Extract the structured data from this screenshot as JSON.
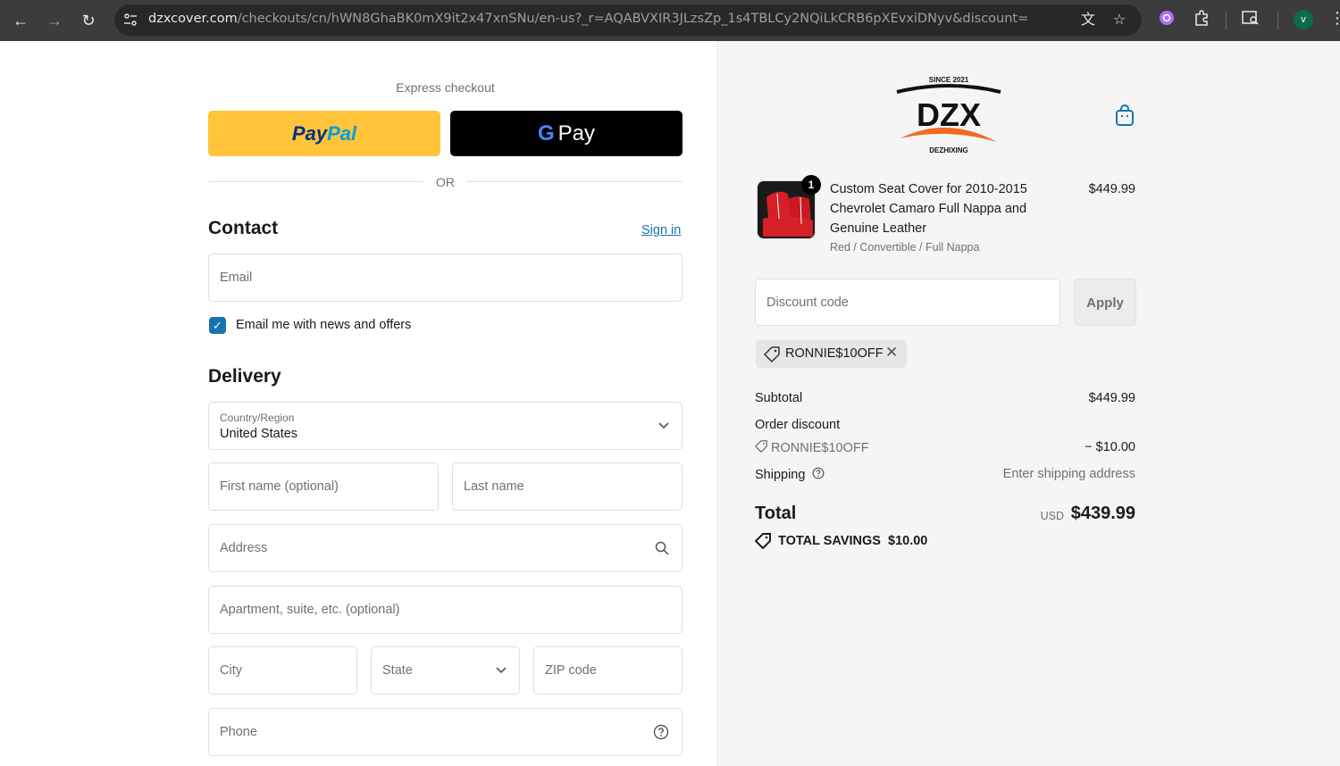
{
  "browser": {
    "url_domain": "dzxcover.com",
    "url_path": "/checkouts/cn/hWN8GhaBK0mX9it2x47xnSNu/en-us?_r=AQABVXIR3JLzsZp_1s4TBLCy2NQiLkCRB6pXEvxiDNyv&discount=",
    "profile_initial": "v"
  },
  "checkout": {
    "express_label": "Express checkout",
    "paypal_part1": "Pay",
    "paypal_part2": "Pal",
    "gpay_g": "G",
    "gpay_label": "Pay",
    "or_label": "OR",
    "contact_title": "Contact",
    "sign_in": "Sign in",
    "email_placeholder": "Email",
    "newsletter_label": "Email me with news and offers",
    "delivery_title": "Delivery",
    "country_label": "Country/Region",
    "country_value": "United States",
    "first_name_placeholder": "First name (optional)",
    "last_name_placeholder": "Last name",
    "address_placeholder": "Address",
    "apartment_placeholder": "Apartment, suite, etc. (optional)",
    "city_placeholder": "City",
    "state_placeholder": "State",
    "zip_placeholder": "ZIP code",
    "phone_placeholder": "Phone"
  },
  "summary": {
    "logo_since": "SINCE 2021",
    "logo_text": "DZX",
    "logo_sub": "DEZHIXING",
    "product": {
      "name": "Custom Seat Cover for 2010-2015 Chevrolet Camaro Full Nappa and Genuine Leather",
      "variant": "Red / Convertible / Full Nappa",
      "price": "$449.99",
      "quantity": "1"
    },
    "discount_placeholder": "Discount code",
    "apply_label": "Apply",
    "applied_code": "RONNIE$10OFF",
    "subtotal_label": "Subtotal",
    "subtotal_value": "$449.99",
    "order_discount_label": "Order discount",
    "order_discount_code": "RONNIE$10OFF",
    "order_discount_value": "− $10.00",
    "shipping_label": "Shipping",
    "shipping_value": "Enter shipping address",
    "total_label": "Total",
    "total_currency": "USD",
    "total_value": "$439.99",
    "savings_label": "TOTAL SAVINGS",
    "savings_value": "$10.00"
  },
  "colors": {
    "accent": "#1773b0",
    "paypal_yellow": "#ffc439",
    "summary_bg": "#f5f5f5"
  }
}
